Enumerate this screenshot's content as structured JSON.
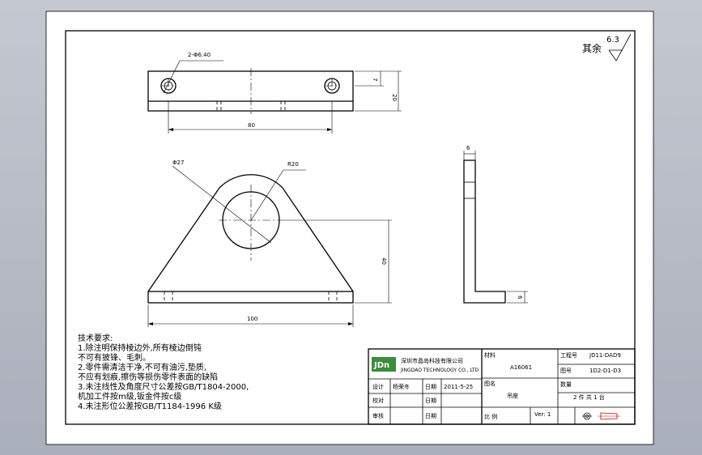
{
  "roughness": {
    "prefix": "其余",
    "value": "6.3"
  },
  "top_view": {
    "hole_callout": "2-Φ6.40",
    "dim_length": "80",
    "dim_height": "20",
    "dim_offset": "7"
  },
  "front_view": {
    "dia_label": "Φ27",
    "radius_label": "R20",
    "dim_height": "40",
    "dim_width": "100"
  },
  "side_view": {
    "dim_thickness": "6",
    "dim_foot": "6"
  },
  "notes": {
    "title": "技术要求:",
    "lines": [
      "1.除注明保持棱边外,所有棱边倒钝",
      "   不可有披锋、毛刺。",
      "2.零件需清洁干净,不可有油污,垫质,",
      "   不应有划痕,擦伤等损伤零件表面的缺陷",
      "3.未注线性及角度尺寸公差按GB/T1804-2000,",
      "   机加工件按m级,钣金件按c级",
      "4.未注形位公差按GB/T1184-1996 K级"
    ]
  },
  "title_block": {
    "logo_text": "JDn",
    "company_cn": "深圳市晶岛科技有限公司",
    "company_en": "JINGDAO TECHNOLOGY CO., LTD",
    "labels": {
      "material": "材料",
      "project_no": "工程号",
      "drawing_name": "图名",
      "drawing_no": "图号",
      "quantity": "数量",
      "design": "设计",
      "check": "校对",
      "approve": "审核",
      "date": "日期",
      "scale": "比 例",
      "version": "Ver: 1"
    },
    "values": {
      "material": "A16061",
      "project_no": "JD11-DAD9",
      "drawing_name": "吊座",
      "drawing_no": "1D2-D1-D3",
      "designer": "杨荣冬",
      "date": "2011-5-25",
      "quantity": "2 件   共 1 台"
    }
  }
}
